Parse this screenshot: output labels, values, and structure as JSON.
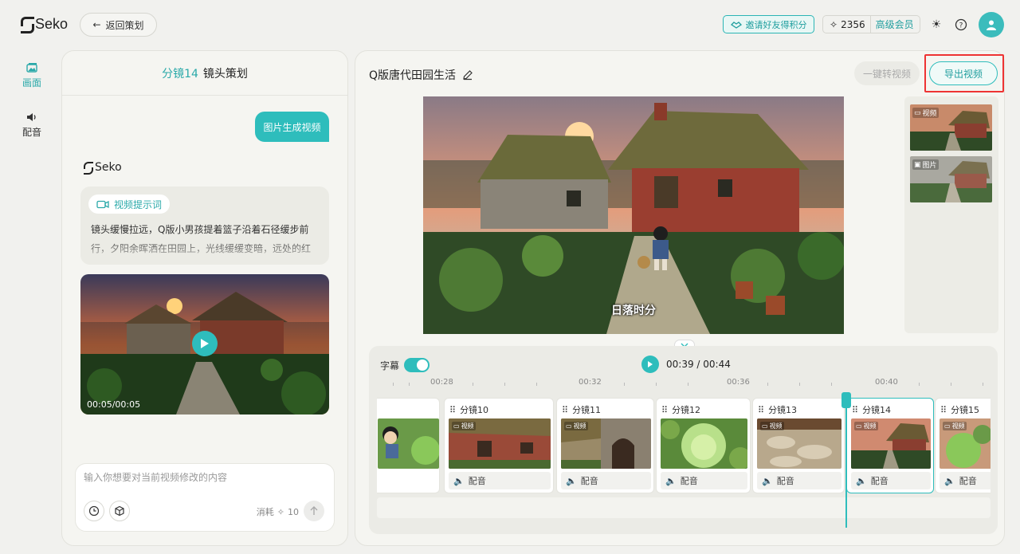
{
  "header": {
    "brand": "Seko",
    "back_label": "返回策划",
    "invite_label": "邀请好友得积分",
    "credits": "2356",
    "vip_label": "高级会员"
  },
  "rail": [
    {
      "label": "画面",
      "icon": "image-icon",
      "active": true
    },
    {
      "label": "配音",
      "icon": "speaker-icon",
      "active": false
    }
  ],
  "left_panel": {
    "title_accent": "分镜14",
    "title": "镜头策划",
    "user_bubble": "图片生成视频",
    "assistant_name": "Seko",
    "prompt_tag": "视频提示词",
    "prompt_text": "镜头缓慢拉远，Q版小男孩提着篮子沿着石径缓步前行，夕阳余晖洒在田园上，光线缓缓变暗，远处的红",
    "video_time": "00:05/00:05",
    "input_placeholder": "输入你想要对当前视频修改的内容",
    "consume_label": "消耗",
    "consume_value": "10"
  },
  "right_panel": {
    "project_title": "Q版唐代田园生活",
    "convert_label": "一键转视频",
    "export_label": "导出视频",
    "subtitle_text": "日落时分",
    "thumbs": [
      {
        "tag": "视频"
      },
      {
        "tag": "图片"
      }
    ]
  },
  "timeline": {
    "subtitle_label": "字幕",
    "subtitle_on": true,
    "current_time": "00:39",
    "total_time": "00:44",
    "time_display": "00:39 / 00:44",
    "ticks": [
      "00:28",
      "00:32",
      "00:36",
      "00:40"
    ],
    "clips": [
      {
        "name": "",
        "tag": "",
        "audio": ""
      },
      {
        "name": "分镜10",
        "tag": "视频",
        "audio": "配音"
      },
      {
        "name": "分镜11",
        "tag": "视频",
        "audio": "配音"
      },
      {
        "name": "分镜12",
        "tag": "",
        "audio": "配音"
      },
      {
        "name": "分镜13",
        "tag": "视频",
        "audio": "配音"
      },
      {
        "name": "分镜14",
        "tag": "视频",
        "audio": "配音"
      },
      {
        "name": "分镜15",
        "tag": "视频",
        "audio": "配音"
      }
    ]
  },
  "colors": {
    "accent": "#2ebdbc",
    "accent_dark": "#1f9e9e",
    "highlight_box": "#ee3333",
    "background": "#f1f1ee"
  }
}
